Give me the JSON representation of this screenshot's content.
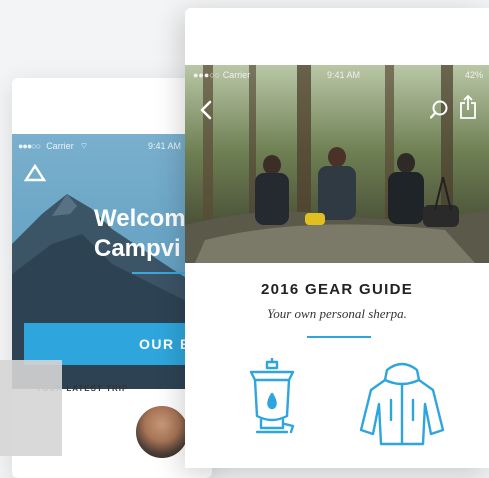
{
  "back_screen": {
    "status": {
      "carrier": "Carrier",
      "time": "9:41 AM"
    },
    "welcome": "Welcom\nCampvi",
    "button_label": "OUR BL",
    "latest_trip_label": "YOUR LATEST TRIP"
  },
  "front_screen": {
    "status": {
      "carrier": "Carrier",
      "time": "9:41 AM",
      "battery": "42%"
    },
    "title": "2016 GEAR GUIDE",
    "subtitle": "Your own personal sherpa."
  },
  "colors": {
    "accent": "#2ea6dd",
    "hero_blue": "#6aa5c6",
    "text_dark": "#222222"
  },
  "icons": {
    "back": "back-arrow-icon",
    "search": "search-icon",
    "share": "share-icon",
    "lantern": "lantern-icon",
    "jacket": "jacket-icon",
    "logo": "tent-logo-icon"
  }
}
